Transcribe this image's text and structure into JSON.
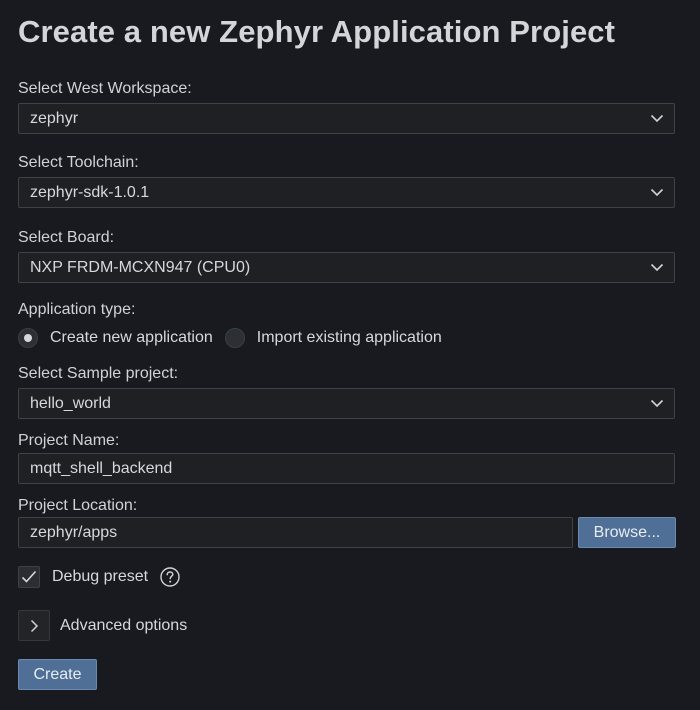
{
  "title": "Create a new Zephyr Application Project",
  "workspace": {
    "label": "Select West Workspace:",
    "value": "zephyr",
    "icon": "chevron-down-icon"
  },
  "toolchain": {
    "label": "Select Toolchain:",
    "value": "zephyr-sdk-1.0.1",
    "icon": "chevron-down-icon"
  },
  "board": {
    "label": "Select Board:",
    "value": "NXP FRDM-MCXN947 (CPU0)",
    "icon": "chevron-down-icon"
  },
  "app_type": {
    "label": "Application type:",
    "options": [
      {
        "label": "Create new application",
        "selected": true
      },
      {
        "label": "Import existing application",
        "selected": false
      }
    ]
  },
  "sample": {
    "label": "Select Sample project:",
    "value": "hello_world",
    "icon": "chevron-down-icon"
  },
  "project_name": {
    "label": "Project Name:",
    "value": "mqtt_shell_backend"
  },
  "project_location": {
    "label": "Project Location:",
    "value": "zephyr/apps",
    "browse_label": "Browse..."
  },
  "debug_preset": {
    "label": "Debug preset",
    "checked": true,
    "help_icon": "help-icon"
  },
  "advanced": {
    "label": "Advanced options",
    "icon": "chevron-right-icon"
  },
  "create_label": "Create",
  "colors": {
    "background": "#181a1f",
    "input_background": "#1e2024",
    "input_border": "#3e4146",
    "primary_button": "#4f6f96",
    "text": "#d6d8dc"
  }
}
